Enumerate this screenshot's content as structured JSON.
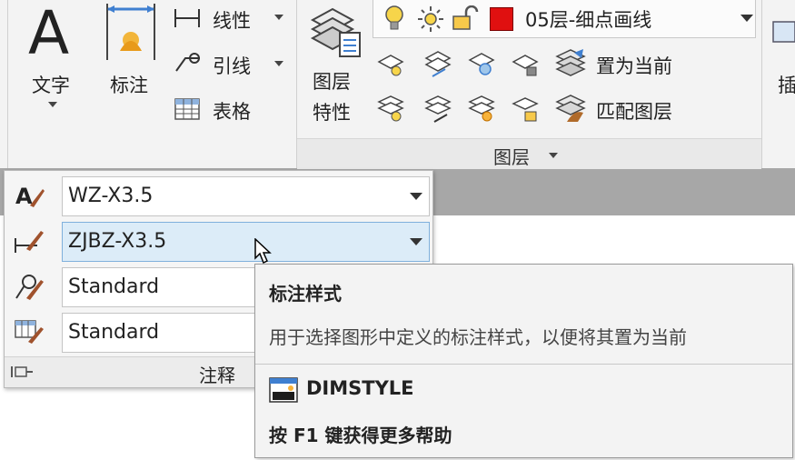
{
  "ribbon": {
    "annotation": {
      "text_button": "文字",
      "dimension_button": "标注",
      "linear": "线性",
      "leader": "引线",
      "table": "表格"
    },
    "layers": {
      "properties_line1": "图层",
      "properties_line2": "特性",
      "current_layer": "05层-细点画线",
      "layer_color": "#e01010",
      "set_current": "置为当前",
      "match_layer": "匹配图层",
      "panel_title": "图层"
    },
    "insert_partial": "插"
  },
  "annotation_panel": {
    "text_style": "WZ-X3.5",
    "dim_style": "ZJBZ-X3.5",
    "leader_style": "Standard",
    "table_style": "Standard",
    "title": "注释"
  },
  "tooltip": {
    "title": "标注样式",
    "description": "用于选择图形中定义的标注样式，以便将其置为当前",
    "command": "DIMSTYLE",
    "help": "按 F1 键获得更多帮助"
  }
}
